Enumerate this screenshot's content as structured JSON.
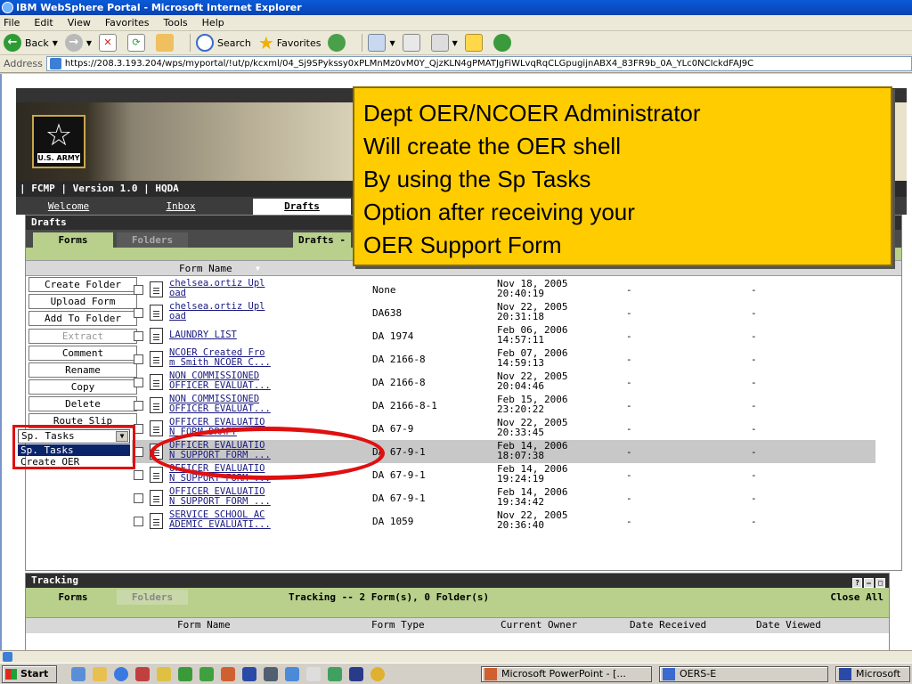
{
  "window": {
    "title": "IBM WebSphere Portal - Microsoft Internet Explorer"
  },
  "menu": [
    "File",
    "Edit",
    "View",
    "Favorites",
    "Tools",
    "Help"
  ],
  "toolbar": {
    "back": "Back",
    "search": "Search",
    "favorites": "Favorites"
  },
  "address": {
    "label": "Address",
    "url": "https://208.3.193.204/wps/myportal/!ut/p/kcxml/04_Sj9SPykssy0xPLMnMz0vM0Y_QjzKLN4gPMATJgFiWLvqRqCLGpugijnABX4_83FR9b_0A_YLc0NCIckdFAJ9C"
  },
  "portal": {
    "version_bar": "| FCMP  |  Version 1.0  |  HQDA",
    "logo_text": "U.S. ARMY",
    "tabs": [
      "Welcome",
      "Inbox",
      "Drafts"
    ],
    "drafts": {
      "title": "Drafts",
      "subtab_forms": "Forms",
      "subtab_folders": "Folders",
      "count_text": "Drafts -",
      "col_form_name": "Form Name"
    },
    "side_buttons": [
      "Create Folder",
      "Upload Form",
      "Add To Folder",
      "Extract",
      "Comment",
      "Rename",
      "Copy",
      "Delete",
      "Route Slip"
    ],
    "select": {
      "value": "Sp. Tasks",
      "options": [
        "Sp. Tasks",
        "Create OER"
      ]
    },
    "rows": [
      {
        "name1": "chelsea.ortiz Upl",
        "name2": "oad",
        "type": "None",
        "date1": "Nov 18, 2005",
        "date2": "20:40:19",
        "c1": "-",
        "c2": "-"
      },
      {
        "name1": "chelsea.ortiz Upl",
        "name2": "oad",
        "type": "DA638",
        "date1": "Nov 22, 2005",
        "date2": "20:31:18",
        "c1": "-",
        "c2": "-"
      },
      {
        "name1": "LAUNDRY LIST",
        "name2": "",
        "type": "DA 1974",
        "date1": "Feb 06, 2006",
        "date2": "14:57:11",
        "c1": "-",
        "c2": "-"
      },
      {
        "name1": "NCOER Created Fro",
        "name2": "m Smith NCOER C...",
        "type": "DA 2166-8",
        "date1": "Feb 07, 2006",
        "date2": "14:59:13",
        "c1": "-",
        "c2": "-"
      },
      {
        "name1": "NON COMMISSIONED",
        "name2": "OFFICER EVALUAT...",
        "type": "DA 2166-8",
        "date1": "Nov 22, 2005",
        "date2": "20:04:46",
        "c1": "-",
        "c2": "-"
      },
      {
        "name1": "NON COMMISSIONED",
        "name2": "OFFICER EVALUAT...",
        "type": "DA 2166-8-1",
        "date1": "Feb 15, 2006",
        "date2": "23:20:22",
        "c1": "-",
        "c2": "-"
      },
      {
        "name1": "OFFICER EVALUATIO",
        "name2": "N FORM DRAFT",
        "type": "DA 67-9",
        "date1": "Nov 22, 2005",
        "date2": "20:33:45",
        "c1": "-",
        "c2": "-"
      },
      {
        "name1": "OFFICER EVALUATIO",
        "name2": "N SUPPORT FORM ...",
        "type": "DA 67-9-1",
        "date1": "Feb 14, 2006",
        "date2": "18:07:38",
        "c1": "-",
        "c2": "-"
      },
      {
        "name1": "OFFICER EVALUATIO",
        "name2": "N SUPPORT FORM ...",
        "type": "DA 67-9-1",
        "date1": "Feb 14, 2006",
        "date2": "19:24:19",
        "c1": "-",
        "c2": "-"
      },
      {
        "name1": "OFFICER EVALUATIO",
        "name2": "N SUPPORT FORM ...",
        "type": "DA 67-9-1",
        "date1": "Feb 14, 2006",
        "date2": "19:34:42",
        "c1": "-",
        "c2": "-"
      },
      {
        "name1": "SERVICE SCHOOL AC",
        "name2": "ADEMIC EVALUATI...",
        "type": "DA 1059",
        "date1": "Nov 22, 2005",
        "date2": "20:36:40",
        "c1": "-",
        "c2": "-"
      }
    ],
    "tracking": {
      "title": "Tracking",
      "subtab_forms": "Forms",
      "subtab_folders": "Folders",
      "count_text": "Tracking -- 2 Form(s), 0 Folder(s)",
      "close_all": "Close All",
      "headers": [
        "Form Name",
        "Form Type",
        "Current Owner",
        "Date Received",
        "Date Viewed"
      ]
    }
  },
  "callout": {
    "lines": [
      "Dept OER/NCOER Administrator",
      "Will create the OER shell",
      "By using the Sp Tasks",
      "Option after receiving your",
      "OER Support Form"
    ]
  },
  "taskbar": {
    "start": "Start",
    "items": [
      "Microsoft PowerPoint - [...",
      "OERS-E",
      "Microsoft"
    ]
  },
  "colors": {
    "callout_bg": "#ffcc00",
    "highlight_red": "#e01010",
    "olive": "#b8d08b"
  }
}
